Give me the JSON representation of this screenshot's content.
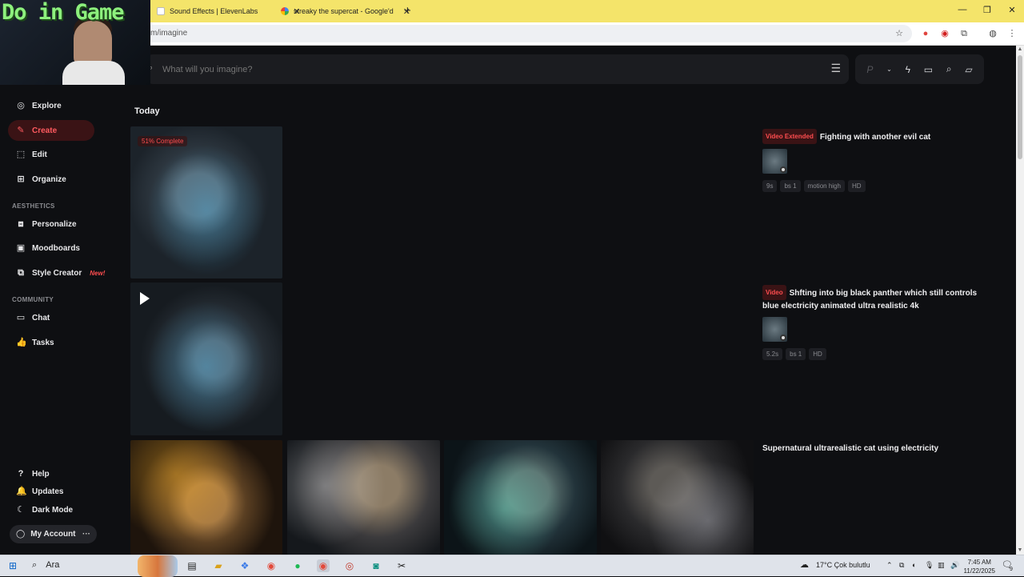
{
  "browser": {
    "tabs": [
      {
        "title": "Sound Effects | ElevenLabs"
      },
      {
        "title": "streaky the supercat - Google'd"
      }
    ],
    "new_tab": "+",
    "url": "m/imagine",
    "window_controls": {
      "minimize": "—",
      "restore": "❐",
      "close": "✕"
    }
  },
  "overlay": {
    "stream_text": "Do in Game"
  },
  "sidebar": {
    "items": [
      {
        "label": "Explore",
        "icon": "compass-icon"
      },
      {
        "label": "Create",
        "icon": "brush-icon",
        "active": true
      },
      {
        "label": "Edit",
        "icon": "edit-icon"
      },
      {
        "label": "Organize",
        "icon": "grid-icon"
      }
    ],
    "aesthetics_label": "AESTHETICS",
    "aesthetics_items": [
      {
        "label": "Personalize"
      },
      {
        "label": "Moodboards"
      },
      {
        "label": "Style Creator",
        "badge": "New!"
      }
    ],
    "community_label": "COMMUNITY",
    "community_items": [
      {
        "label": "Chat"
      },
      {
        "label": "Tasks"
      }
    ],
    "footer_items": [
      {
        "label": "Help"
      },
      {
        "label": "Updates"
      },
      {
        "label": "Dark Mode"
      }
    ],
    "account": {
      "label": "My Account",
      "more": "···"
    }
  },
  "search": {
    "placeholder": "What will you imagine?"
  },
  "tools": {
    "p": "P"
  },
  "feed": {
    "section_title": "Today",
    "jobs": [
      {
        "progress": "51% Complete",
        "tag": "Video Extended",
        "prompt": "Fighting with another evil cat",
        "chips": [
          "9s",
          "bs 1",
          "motion high",
          "HD"
        ]
      },
      {
        "tag": "Video",
        "prompt": "Shfting into big black panther which still controls blue electricity animated ultra realistic 4k",
        "chips": [
          "5.2s",
          "bs 1",
          "HD"
        ]
      },
      {
        "prompt": "Supernatural ultrarealistic cat using electricity"
      }
    ]
  },
  "taskbar": {
    "search": "Ara",
    "weather": "17°C  Çok bulutlu",
    "time": "7:45 AM",
    "date": "11/22/2025",
    "notif": "9"
  },
  "colors": {
    "accent": "#ff4d4f",
    "bg": "#0e0f12",
    "panel": "#1b1c20"
  }
}
